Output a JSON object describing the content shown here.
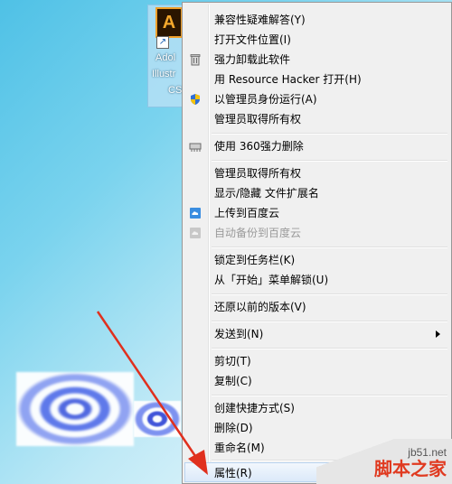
{
  "desktop_icon": {
    "tile_letter": "A",
    "label_lines": [
      "Adol",
      "Illustr",
      "CS6"
    ],
    "shortcut_glyph": "↗"
  },
  "context_menu": {
    "items": [
      {
        "label": "兼容性疑难解答(Y)",
        "icon": null
      },
      {
        "label": "打开文件位置(I)",
        "icon": null
      },
      {
        "label": "强力卸载此软件",
        "icon": "trash-icon"
      },
      {
        "label": "用 Resource Hacker 打开(H)",
        "icon": null
      },
      {
        "label": "以管理员身份运行(A)",
        "icon": "uac-shield-icon"
      },
      {
        "label": "管理员取得所有权",
        "icon": null
      },
      {
        "label": "使用 360强力删除",
        "icon": "shredder-icon"
      },
      {
        "label": "管理员取得所有权",
        "icon": null
      },
      {
        "label": "显示/隐藏 文件扩展名",
        "icon": null
      },
      {
        "label": "上传到百度云",
        "icon": "baidu-cloud-icon"
      },
      {
        "label": "自动备份到百度云",
        "icon": "baidu-cloud-icon",
        "disabled": true
      },
      {
        "label": "锁定到任务栏(K)",
        "icon": null
      },
      {
        "label": "从「开始」菜单解锁(U)",
        "icon": null
      },
      {
        "label": "还原以前的版本(V)",
        "icon": null
      },
      {
        "label": "发送到(N)",
        "icon": null,
        "submenu": true
      },
      {
        "label": "剪切(T)",
        "icon": null
      },
      {
        "label": "复制(C)",
        "icon": null
      },
      {
        "label": "创建快捷方式(S)",
        "icon": null
      },
      {
        "label": "删除(D)",
        "icon": null
      },
      {
        "label": "重命名(M)",
        "icon": null
      },
      {
        "label": "属性(R)",
        "icon": null,
        "highlighted": true
      }
    ]
  },
  "watermark": {
    "site": "jb51.net",
    "name": "脚本之家"
  },
  "colors": {
    "menu_bg": "#f0f0f0",
    "highlight": "#dbe9f9",
    "arrow": "#e0301e",
    "watermark_red": "#e03a20"
  }
}
